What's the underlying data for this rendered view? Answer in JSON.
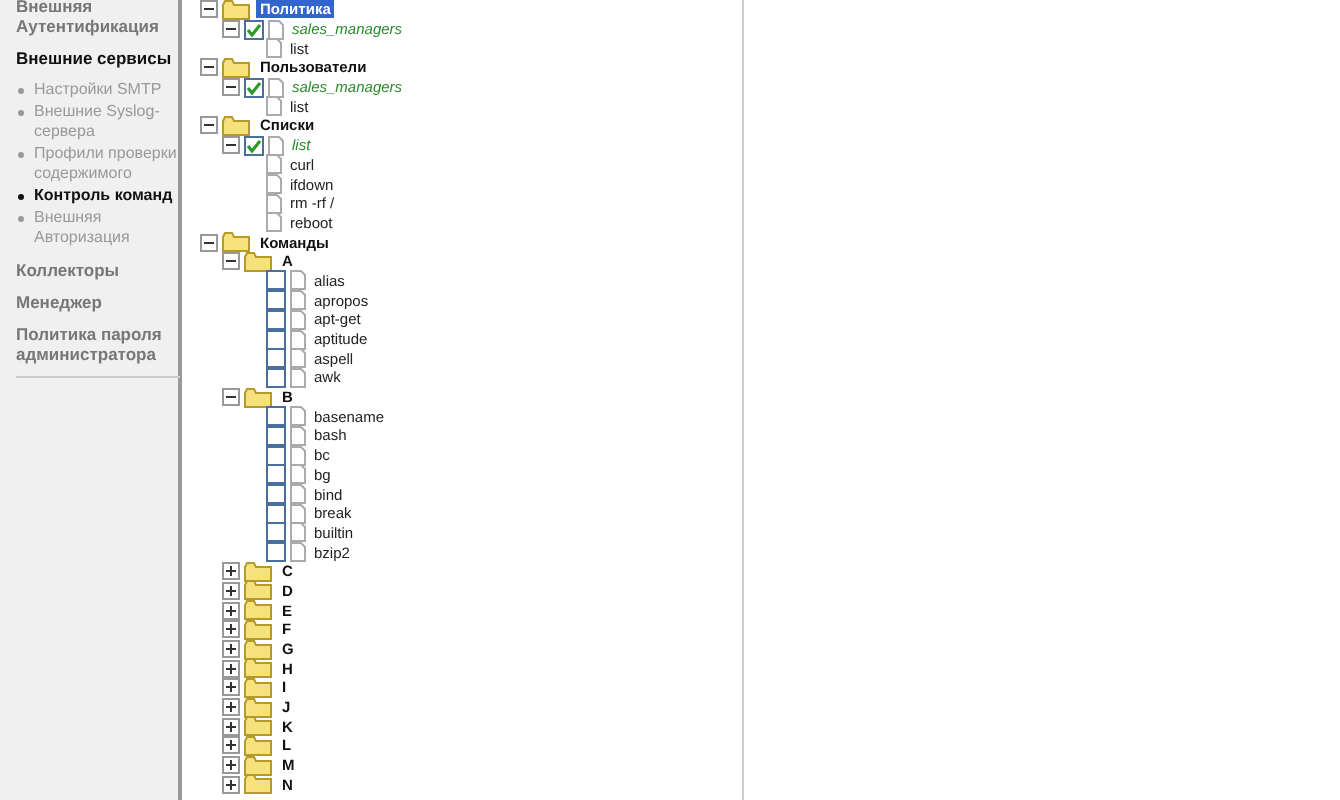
{
  "sidebar": {
    "items": [
      {
        "label": "Внешняя Аутентификация",
        "selected": false
      },
      {
        "label": "Внешние сервисы",
        "selected": true,
        "children": [
          {
            "label": "Настройки SMTP",
            "selected": false
          },
          {
            "label": "Внешние Syslog-сервера",
            "selected": false
          },
          {
            "label": "Профили проверки содержимого",
            "selected": false
          },
          {
            "label": "Контроль команд",
            "selected": true
          },
          {
            "label": "Внешняя Авторизация",
            "selected": false
          }
        ]
      },
      {
        "label": "Коллекторы",
        "selected": false
      },
      {
        "label": "Менеджер",
        "selected": false
      },
      {
        "label": "Политика пароля администратора",
        "selected": false
      }
    ]
  },
  "tree": [
    {
      "kind": "folder",
      "label": "Политика",
      "selected": true,
      "expanded": true,
      "children": [
        {
          "kind": "group",
          "label": "sales_managers",
          "checked": true,
          "expanded": true,
          "children": [
            {
              "kind": "leaf",
              "label": "list"
            }
          ]
        }
      ]
    },
    {
      "kind": "folder",
      "label": "Пользователи",
      "selected": false,
      "expanded": true,
      "children": [
        {
          "kind": "group",
          "label": "sales_managers",
          "checked": true,
          "expanded": true,
          "children": [
            {
              "kind": "leaf",
              "label": "list"
            }
          ]
        }
      ]
    },
    {
      "kind": "folder",
      "label": "Списки",
      "selected": false,
      "expanded": true,
      "children": [
        {
          "kind": "group",
          "label": "list",
          "checked": true,
          "expanded": true,
          "children": [
            {
              "kind": "leaf",
              "label": "curl"
            },
            {
              "kind": "leaf",
              "label": "ifdown"
            },
            {
              "kind": "leaf",
              "label": "rm -rf /"
            },
            {
              "kind": "leaf",
              "label": "reboot"
            }
          ]
        }
      ]
    },
    {
      "kind": "folder",
      "label": "Команды",
      "selected": false,
      "expanded": true,
      "children": [
        {
          "kind": "folder",
          "label": "A",
          "selected": false,
          "expanded": true,
          "children": [
            {
              "kind": "group",
              "label": "alias",
              "checked": false
            },
            {
              "kind": "group",
              "label": "apropos",
              "checked": false
            },
            {
              "kind": "group",
              "label": "apt-get",
              "checked": false
            },
            {
              "kind": "group",
              "label": "aptitude",
              "checked": false
            },
            {
              "kind": "group",
              "label": "aspell",
              "checked": false
            },
            {
              "kind": "group",
              "label": "awk",
              "checked": false
            }
          ]
        },
        {
          "kind": "folder",
          "label": "B",
          "selected": false,
          "expanded": true,
          "children": [
            {
              "kind": "group",
              "label": "basename",
              "checked": false
            },
            {
              "kind": "group",
              "label": "bash",
              "checked": false
            },
            {
              "kind": "group",
              "label": "bc",
              "checked": false
            },
            {
              "kind": "group",
              "label": "bg",
              "checked": false
            },
            {
              "kind": "group",
              "label": "bind",
              "checked": false
            },
            {
              "kind": "group",
              "label": "break",
              "checked": false
            },
            {
              "kind": "group",
              "label": "builtin",
              "checked": false
            },
            {
              "kind": "group",
              "label": "bzip2",
              "checked": false
            }
          ]
        },
        {
          "kind": "folder",
          "label": "C",
          "selected": false,
          "expanded": false
        },
        {
          "kind": "folder",
          "label": "D",
          "selected": false,
          "expanded": false
        },
        {
          "kind": "folder",
          "label": "E",
          "selected": false,
          "expanded": false
        },
        {
          "kind": "folder",
          "label": "F",
          "selected": false,
          "expanded": false
        },
        {
          "kind": "folder",
          "label": "G",
          "selected": false,
          "expanded": false
        },
        {
          "kind": "folder",
          "label": "H",
          "selected": false,
          "expanded": false
        },
        {
          "kind": "folder",
          "label": "I",
          "selected": false,
          "expanded": false
        },
        {
          "kind": "folder",
          "label": "J",
          "selected": false,
          "expanded": false
        },
        {
          "kind": "folder",
          "label": "K",
          "selected": false,
          "expanded": false
        },
        {
          "kind": "folder",
          "label": "L",
          "selected": false,
          "expanded": false
        },
        {
          "kind": "folder",
          "label": "M",
          "selected": false,
          "expanded": false
        },
        {
          "kind": "folder",
          "label": "N",
          "selected": false,
          "expanded": false
        }
      ]
    }
  ]
}
